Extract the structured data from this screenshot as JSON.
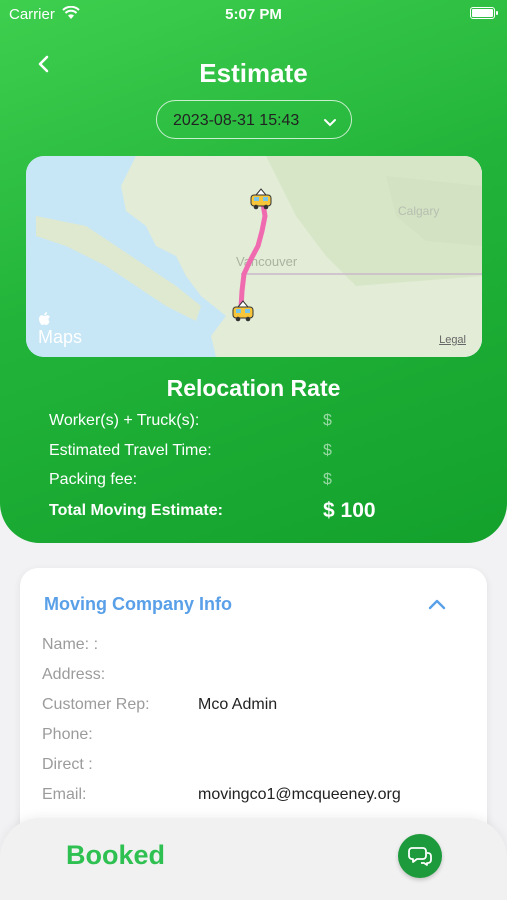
{
  "status_bar": {
    "carrier": "Carrier",
    "time": "5:07 PM"
  },
  "header": {
    "title": "Estimate"
  },
  "date_picker": {
    "value": "2023-08-31 15:43"
  },
  "map": {
    "logo": "Maps",
    "legal": "Legal",
    "place_labels": [
      "Vancouver",
      "Calgary"
    ]
  },
  "rate": {
    "title": "Relocation Rate",
    "rows": [
      {
        "label": "Worker(s) + Truck(s):",
        "value": "$"
      },
      {
        "label": "Estimated Travel Time:",
        "value": "$"
      },
      {
        "label": "Packing fee:",
        "value": "$"
      }
    ],
    "total_label": "Total Moving Estimate:",
    "total_value": "$ 100"
  },
  "company": {
    "title": "Moving Company Info",
    "fields": [
      {
        "label": "Name: :",
        "value": ""
      },
      {
        "label": "Address:",
        "value": ""
      },
      {
        "label": "Customer Rep:",
        "value": "Mco Admin"
      },
      {
        "label": "Phone:",
        "value": ""
      },
      {
        "label": "Direct :",
        "value": ""
      },
      {
        "label": "Email:",
        "value": "movingco1@mcqueeney.org"
      }
    ]
  },
  "footer": {
    "status": "Booked"
  },
  "colors": {
    "primary_green": "#22b43a",
    "link_blue": "#5aa0e8",
    "route_pink": "#f06ab0"
  }
}
